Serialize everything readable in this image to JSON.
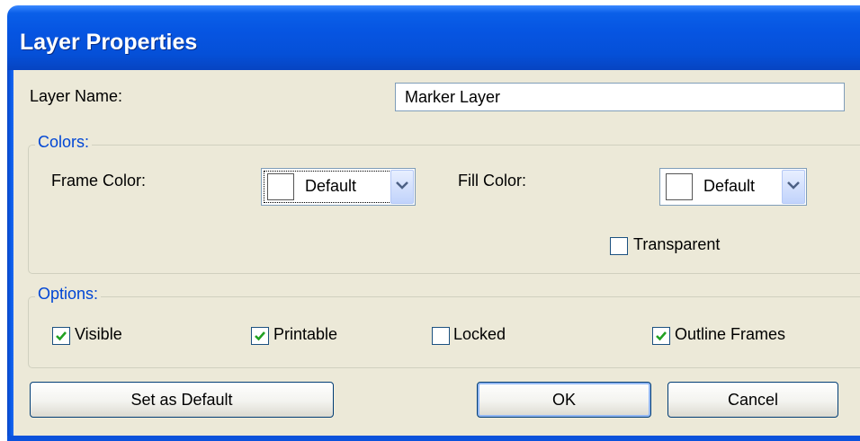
{
  "window": {
    "title": "Layer Properties"
  },
  "layer_name": {
    "label": "Layer Name:",
    "value": "Marker Layer"
  },
  "colors": {
    "group_label": "Colors:",
    "frame_color": {
      "label": "Frame Color:",
      "value": "Default",
      "swatch": "#ffffff"
    },
    "fill_color": {
      "label": "Fill Color:",
      "value": "Default",
      "swatch": "#ffffff"
    },
    "transparent": {
      "label": "Transparent",
      "checked": false
    }
  },
  "options": {
    "group_label": "Options:",
    "visible": {
      "label": "Visible",
      "checked": true
    },
    "printable": {
      "label": "Printable",
      "checked": true
    },
    "locked": {
      "label": "Locked",
      "checked": false
    },
    "outline_frames": {
      "label": "Outline Frames",
      "checked": true
    }
  },
  "buttons": {
    "set_default": "Set as Default",
    "ok": "OK",
    "cancel": "Cancel"
  },
  "theme": {
    "title_bar": "#0655e2",
    "dialog_bg": "#ece9d8",
    "group_title": "#0046d5",
    "check_mark": "#21a121"
  }
}
